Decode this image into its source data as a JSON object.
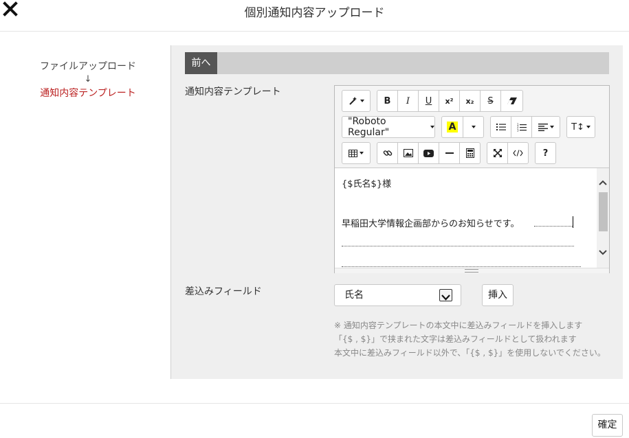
{
  "header": {
    "title": "個別通知内容アップロード"
  },
  "steps": {
    "step1": "ファイルアップロード",
    "arrow": "↓",
    "step2": "通知内容テンプレート"
  },
  "nav": {
    "prev_label": "前へ"
  },
  "template_label": "通知内容テンプレート",
  "toolbar": {
    "bold": "B",
    "italic": "I",
    "underline": "U",
    "superscript": "x²",
    "subscript": "x₂",
    "strike": "S",
    "font_name": "\"Roboto Regular\"",
    "highlight": "A",
    "font_size": "T↕",
    "help": "?"
  },
  "editor": {
    "line1": "{$氏名$}様",
    "line2": "早稲田大学情報企画部からのお知らせです。"
  },
  "merge": {
    "label": "差込みフィールド",
    "selected": "氏名",
    "insert_label": "挿入"
  },
  "notes": [
    "※ 通知内容テンプレートの本文中に差込みフィールドを挿入します",
    "「{$ , $}」で挟まれた文字は差込みフィールドとして扱われます",
    "本文中に差込みフィールド以外で、「{$ , $}」を使用しないでください。"
  ],
  "footer": {
    "confirm_label": "確定"
  },
  "colors": {
    "accent_red": "#b22222",
    "prev_button": "#555555",
    "panel_bg": "#efefef",
    "highlight": "#ffff00"
  }
}
